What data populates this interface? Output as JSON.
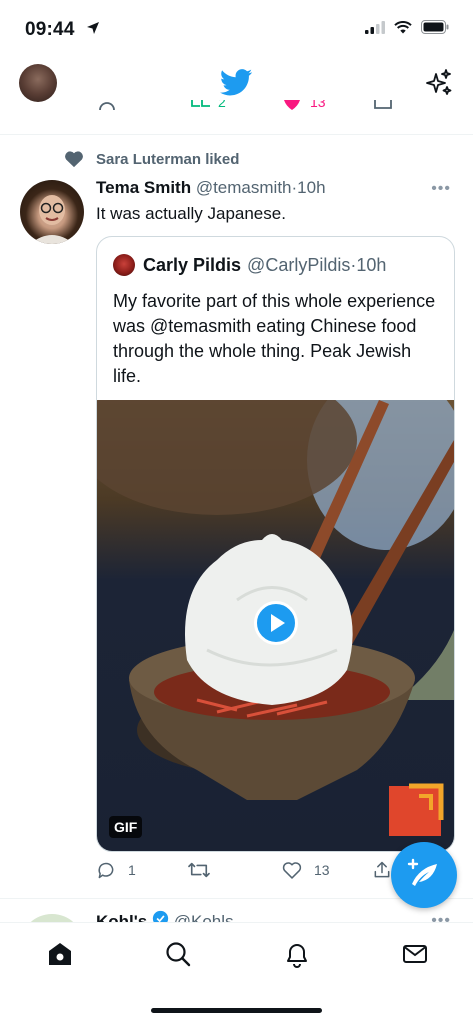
{
  "status": {
    "time": "09:44"
  },
  "header": {
    "brand_color": "#1d9bf0"
  },
  "peek_counts": {
    "retweets": "2",
    "likes": "13"
  },
  "social_context": "Sara Luterman liked",
  "tweet": {
    "name": "Tema Smith",
    "handle": "@temasmith",
    "sep": "·",
    "time": "10h",
    "text": "It was actually Japanese.",
    "more": "•••",
    "quote": {
      "name": "Carly Pildis",
      "handle": "@CarlyPildis",
      "sep": "·",
      "time": "10h",
      "text": "My favorite part of this whole experience was @temasmith eating Chinese food through the whole thing. Peak Jewish life.",
      "media_badge": "GIF"
    },
    "counts": {
      "replies": "1",
      "likes": "13"
    }
  },
  "next_tweet": {
    "name": "Kohl's",
    "handle": "@Kohls"
  },
  "colors": {
    "accent": "#1d9bf0",
    "text": "#0f1419",
    "secondary": "#536471",
    "like_green": "#00ba7c",
    "like_red": "#f91880"
  }
}
